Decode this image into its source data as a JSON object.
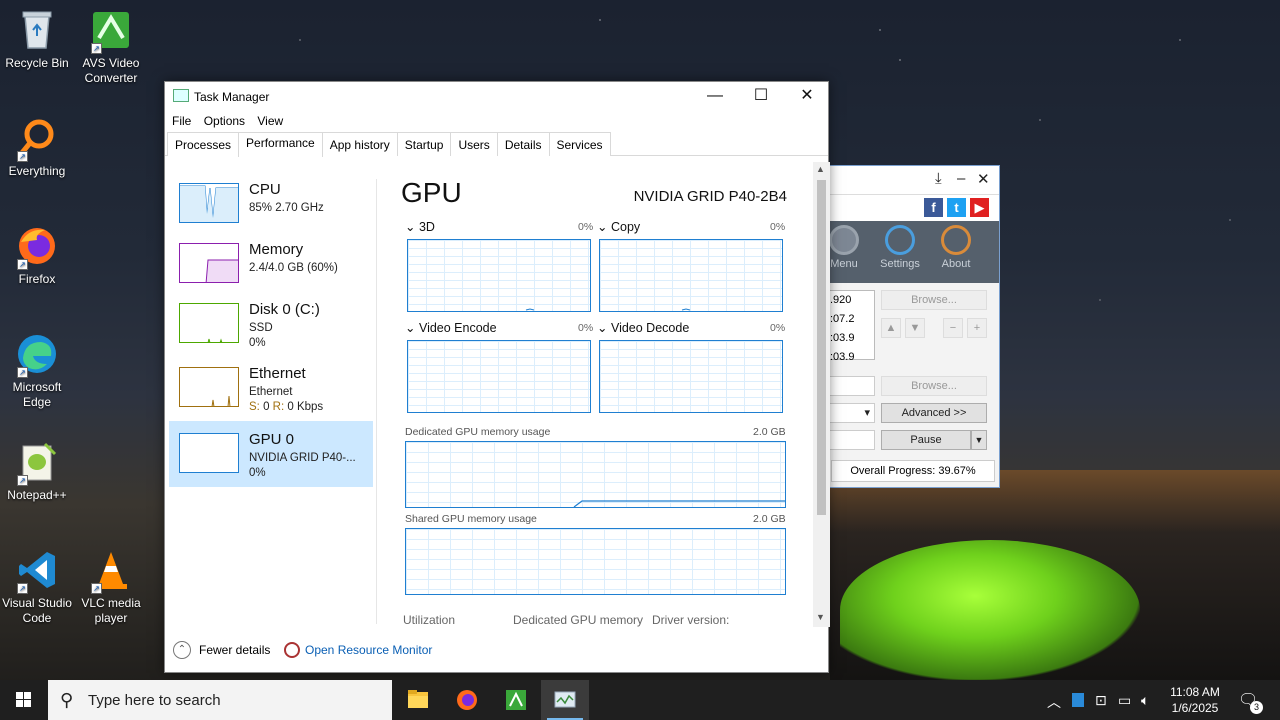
{
  "desktop": {
    "icons": [
      {
        "label": "Recycle Bin"
      },
      {
        "label": "AVS Video Converter"
      },
      {
        "label": "Everything"
      },
      {
        "label": "Firefox"
      },
      {
        "label": "Microsoft Edge"
      },
      {
        "label": "Notepad++"
      },
      {
        "label": "Visual Studio Code"
      },
      {
        "label": "VLC media player"
      }
    ]
  },
  "bg_window": {
    "tools": [
      "Menu",
      "Settings",
      "About"
    ],
    "list_values": [
      ".920",
      ":07.2",
      ":03.9",
      ":03.9"
    ],
    "browse1": "Browse...",
    "browse2": "Browse...",
    "advanced": "Advanced >>",
    "pause": "Pause",
    "progress_label": "Overall Progress: 39.67%",
    "progress_value": 39.67
  },
  "task_manager": {
    "title": "Task Manager",
    "menu": [
      "File",
      "Options",
      "View"
    ],
    "tabs": [
      "Processes",
      "Performance",
      "App history",
      "Startup",
      "Users",
      "Details",
      "Services"
    ],
    "active_tab": "Performance",
    "sidebar": [
      {
        "name": "CPU",
        "sub1": "85%  2.70 GHz",
        "sub2": "",
        "color": "#1f7fd1"
      },
      {
        "name": "Memory",
        "sub1": "2.4/4.0 GB (60%)",
        "sub2": "",
        "color": "#8b1fae"
      },
      {
        "name": "Disk 0 (C:)",
        "sub1": "SSD",
        "sub2": "0%",
        "color": "#4da800"
      },
      {
        "name": "Ethernet",
        "sub1": "Ethernet",
        "sub2_prefix": "S:",
        "sub2_s": " 0 ",
        "sub2_r_prefix": "R:",
        "sub2_r": " 0 Kbps",
        "color": "#a0700f"
      },
      {
        "name": "GPU 0",
        "sub1": "NVIDIA GRID P40-...",
        "sub2": "0%",
        "color": "#1f7fd1"
      }
    ],
    "gpu": {
      "title": "GPU",
      "model": "NVIDIA GRID P40-2B4",
      "engines": [
        {
          "label": "3D",
          "pct": "0%"
        },
        {
          "label": "Copy",
          "pct": "0%"
        },
        {
          "label": "Video Encode",
          "pct": "0%"
        },
        {
          "label": "Video Decode",
          "pct": "0%"
        }
      ],
      "dedicated_label": "Dedicated GPU memory usage",
      "dedicated_max": "2.0 GB",
      "shared_label": "Shared GPU memory usage",
      "shared_max": "2.0 GB",
      "stats": [
        "Utilization",
        "Dedicated GPU memory",
        "Driver version:"
      ]
    },
    "footer": {
      "fewer_details": "Fewer details",
      "resource_monitor": "Open Resource Monitor"
    }
  },
  "taskbar": {
    "search_placeholder": "Type here to search",
    "time": "11:08 AM",
    "date": "1/6/2025",
    "notification_count": "3"
  }
}
